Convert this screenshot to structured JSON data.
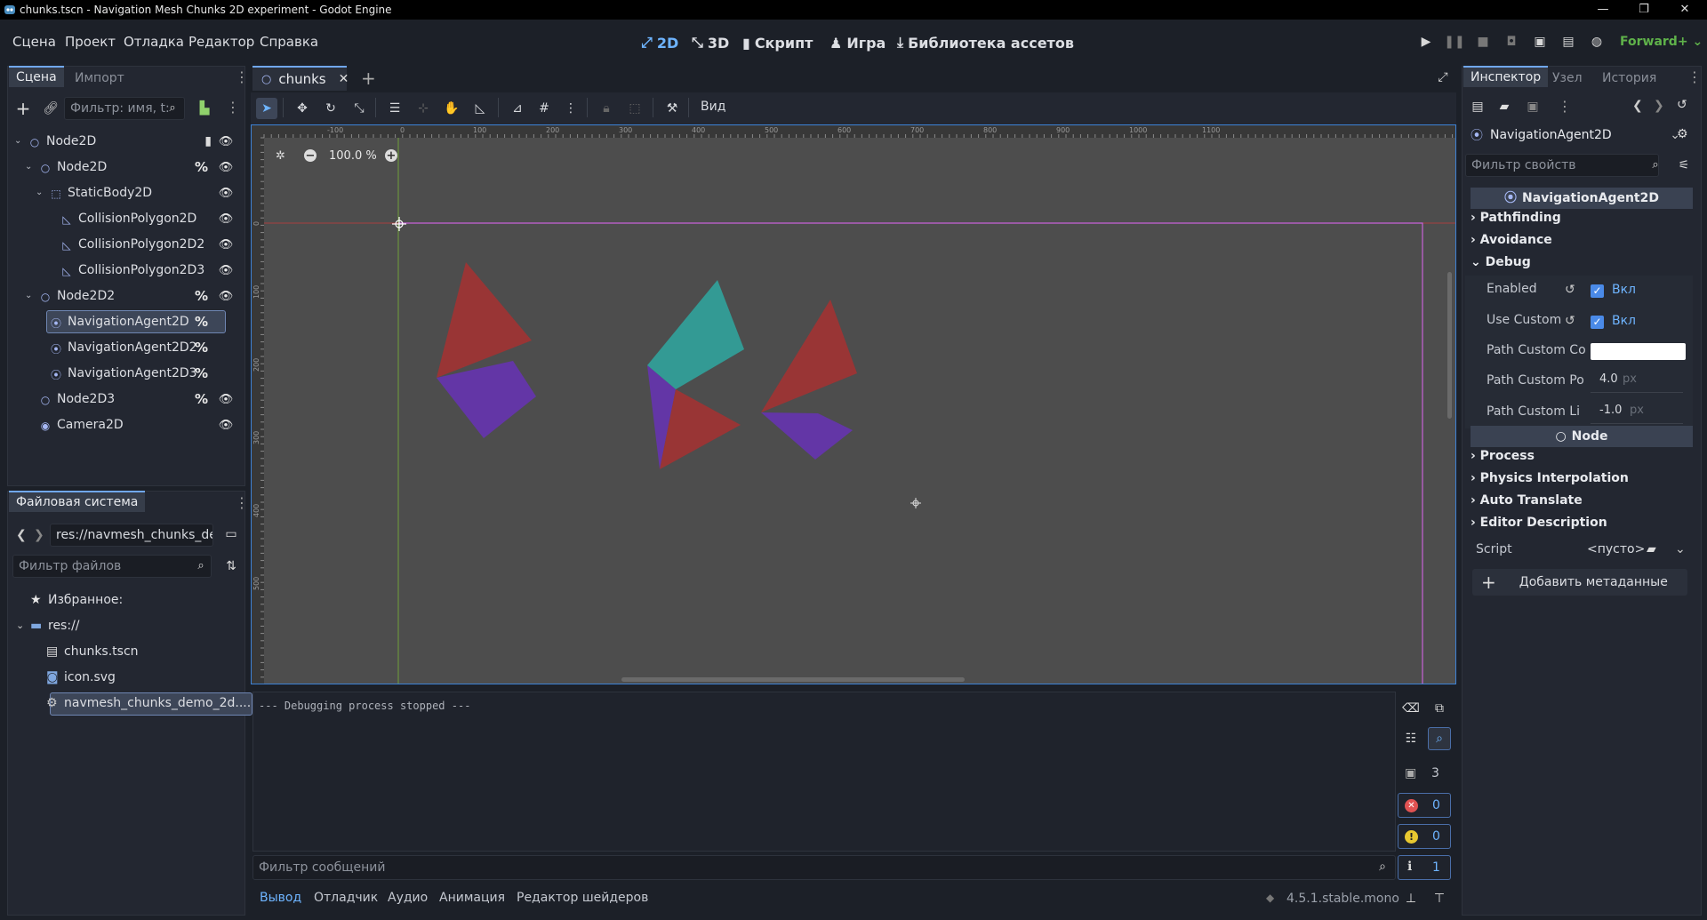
{
  "window": {
    "title": "chunks.tscn - Navigation Mesh Chunks 2D experiment - Godot Engine",
    "controls": [
      "—",
      "❐",
      "✕"
    ]
  },
  "menu": [
    "Сцена",
    "Проект",
    "Отладка",
    "Редактор",
    "Справка"
  ],
  "workspaces": [
    {
      "label": "2D",
      "icon": "2d-icon",
      "active": true
    },
    {
      "label": "3D",
      "icon": "3d-icon",
      "active": false
    },
    {
      "label": "Скрипт",
      "icon": "script-icon",
      "active": false
    },
    {
      "label": "Игра",
      "icon": "game-icon",
      "active": false
    },
    {
      "label": "Библиотека ассетов",
      "icon": "asset-library-icon",
      "active": false
    }
  ],
  "renderer": "Forward+",
  "scene_dock": {
    "tabs": [
      "Сцена",
      "Импорт"
    ],
    "filter_placeholder": "Фильтр: имя, t:",
    "tree": [
      {
        "label": "Node2D",
        "icon": "node2d-icon",
        "depth": 0,
        "arrow": "open",
        "script": true,
        "group": false,
        "visible": true
      },
      {
        "label": "Node2D",
        "icon": "node2d-icon",
        "depth": 1,
        "arrow": "open",
        "group": true,
        "visible": true
      },
      {
        "label": "StaticBody2D",
        "icon": "staticbody2d-icon",
        "depth": 2,
        "arrow": "open",
        "group": false,
        "visible": true
      },
      {
        "label": "CollisionPolygon2D",
        "icon": "collisionpolygon2d-icon",
        "depth": 3,
        "group": false,
        "visible": true
      },
      {
        "label": "CollisionPolygon2D2",
        "icon": "collisionpolygon2d-icon",
        "depth": 3,
        "group": false,
        "visible": true
      },
      {
        "label": "CollisionPolygon2D3",
        "icon": "collisionpolygon2d-icon",
        "depth": 3,
        "group": false,
        "visible": true
      },
      {
        "label": "Node2D2",
        "icon": "node2d-icon",
        "depth": 1,
        "arrow": "open",
        "group": true,
        "visible": true
      },
      {
        "label": "NavigationAgent2D",
        "icon": "navigationagent2d-icon",
        "depth": 2,
        "group": true,
        "selected": true
      },
      {
        "label": "NavigationAgent2D2",
        "icon": "navigationagent2d-icon",
        "depth": 2,
        "group": true
      },
      {
        "label": "NavigationAgent2D3",
        "icon": "navigationagent2d-icon",
        "depth": 2,
        "group": true
      },
      {
        "label": "Node2D3",
        "icon": "node2d-icon",
        "depth": 1,
        "group": true,
        "visible": true
      },
      {
        "label": "Camera2D",
        "icon": "camera2d-icon",
        "depth": 1,
        "group": false,
        "visible": true
      }
    ]
  },
  "filesystem_dock": {
    "title": "Файловая система",
    "path": "res://navmesh_chunks_de",
    "filter_placeholder": "Фильтр файлов",
    "items": [
      {
        "label": "Избранное:",
        "icon": "star-icon",
        "indent": 0
      },
      {
        "label": "res://",
        "icon": "folder-icon",
        "indent": 0
      },
      {
        "label": "chunks.tscn",
        "icon": "scene-file-icon",
        "indent": 1
      },
      {
        "label": "icon.svg",
        "icon": "image-file-icon",
        "indent": 1
      },
      {
        "label": "navmesh_chunks_demo_2d....",
        "icon": "gear-icon",
        "indent": 1,
        "selected": true
      }
    ]
  },
  "editor": {
    "scene_tab": "chunks",
    "zoom": "100.0 %",
    "view_menu": "Вид",
    "ruler_top": [
      "-100",
      "0",
      "100",
      "200",
      "300",
      "400",
      "500",
      "600",
      "700",
      "800",
      "900",
      "1000",
      "1100"
    ],
    "ruler_left": [
      "0",
      "100",
      "200",
      "300",
      "400",
      "500"
    ]
  },
  "output": {
    "log": "--- Debugging process stopped ---",
    "filter_placeholder": "Фильтр сообщений",
    "counts": {
      "messages": "3",
      "errors": "0",
      "warnings": "0",
      "info": "1"
    }
  },
  "bottom_tabs": [
    "Вывод",
    "Отладчик",
    "Аудио",
    "Анимация",
    "Редактор шейдеров"
  ],
  "version": "4.5.1.stable.mono",
  "inspector": {
    "tabs": [
      "Инспектор",
      "Узел",
      "История"
    ],
    "object": "NavigationAgent2D",
    "filter_placeholder": "Фильтр свойств",
    "class_header": "NavigationAgent2D",
    "sections": [
      "Pathfinding",
      "Avoidance",
      "Debug"
    ],
    "debug_props": {
      "enabled_label": "Enabled",
      "enabled_value": "Вкл",
      "use_custom_label": "Use Custom",
      "use_custom_value": "Вкл",
      "path_color_label": "Path Custom Co",
      "path_color": "#ffffff",
      "path_point_label": "Path Custom Po",
      "path_point_value": "4.0",
      "path_line_label": "Path Custom Li",
      "path_line_value": "-1.0",
      "unit": "px"
    },
    "node_header": "Node",
    "node_sections": [
      "Process",
      "Physics Interpolation",
      "Auto Translate",
      "Editor Description"
    ],
    "script_label": "Script",
    "script_value": "<пусто>",
    "add_metadata": "Добавить метаданные"
  },
  "colors": {
    "accent": "#6eb4ff",
    "canvas_bg": "#4d4d4d",
    "poly_red": "#993535",
    "poly_purple": "#6336a6",
    "poly_teal": "#339a94",
    "frame": "#c862d8"
  }
}
